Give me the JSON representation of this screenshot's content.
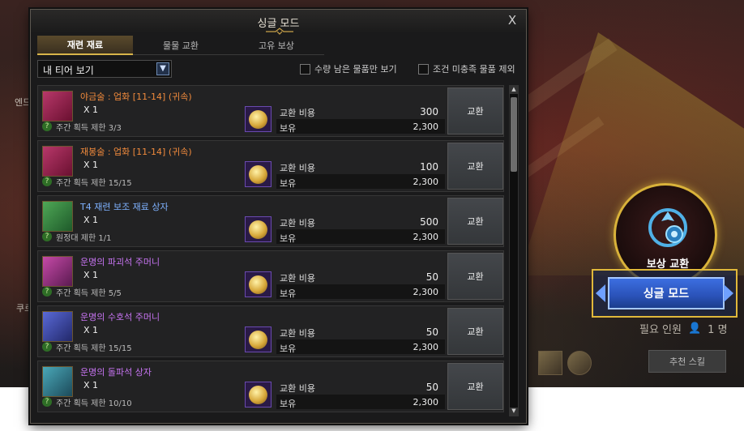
{
  "scene": {
    "left_text_1": "엔드",
    "left_text_2": "쿠르",
    "reward_label": "보상 교환",
    "single_mode_button": "싱글 모드",
    "required_label": "필요 인원",
    "required_count": "1 명",
    "recommend_button": "추천 스킬"
  },
  "modal": {
    "title": "싱글 모드",
    "close": "X",
    "tabs": [
      {
        "label": "재련 재료",
        "active": true
      },
      {
        "label": "물물 교환",
        "active": false
      },
      {
        "label": "고유 보상",
        "active": false
      }
    ],
    "filter": {
      "tier_select": "내 티어 보기",
      "check_remaining": "수량 남은 물품만 보기",
      "check_exclude": "조건 미충족 물품 제외"
    },
    "cost_label": "교환 비용",
    "own_label": "보유",
    "exchange_label": "교환",
    "items": [
      {
        "name": "야금술 : 업화 [11-14] (귀속)",
        "color": "orange",
        "qty": "X 1",
        "limit": "주간 획득 제한 3/3",
        "cost": "300",
        "owned": "2,300",
        "icon": "red-book-icon"
      },
      {
        "name": "재봉술 : 업화 [11-14] (귀속)",
        "color": "orange",
        "qty": "X 1",
        "limit": "주간 획득 제한 15/15",
        "cost": "100",
        "owned": "2,300",
        "icon": "red-book-icon"
      },
      {
        "name": "T4 재련 보조 재료 상자",
        "color": "blue",
        "qty": "X 1",
        "limit": "원정대 제한 1/1",
        "cost": "500",
        "owned": "2,300",
        "icon": "green-chest-icon"
      },
      {
        "name": "운명의 파괴석 주머니",
        "color": "purple",
        "qty": "X 1",
        "limit": "주간 획득 제한 5/5",
        "cost": "50",
        "owned": "2,300",
        "icon": "pink-pouch-icon"
      },
      {
        "name": "운명의 수호석 주머니",
        "color": "purple",
        "qty": "X 1",
        "limit": "주간 획득 제한 15/15",
        "cost": "50",
        "owned": "2,300",
        "icon": "blue-pouch-icon"
      },
      {
        "name": "운명의 돌파석 상자",
        "color": "purple",
        "qty": "X 1",
        "limit": "주간 획득 제한 10/10",
        "cost": "50",
        "owned": "2,300",
        "icon": "teal-chest-icon"
      }
    ]
  }
}
